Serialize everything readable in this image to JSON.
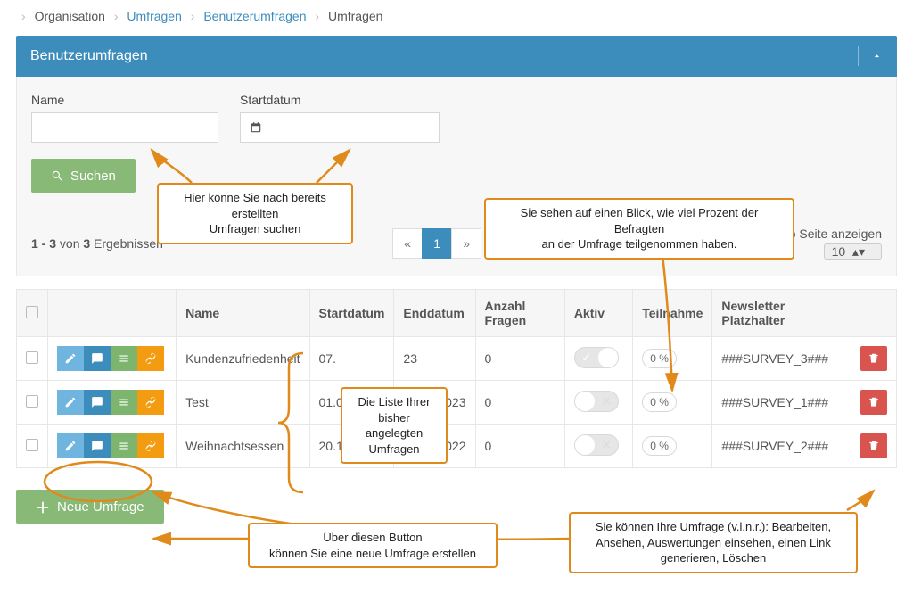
{
  "breadcrumb": {
    "root": "Organisation",
    "a": "Umfragen",
    "b": "Benutzerumfragen",
    "c": "Umfragen"
  },
  "panel": {
    "title": "Benutzerumfragen",
    "name_label": "Name",
    "date_label": "Startdatum",
    "search_btn": "Suchen",
    "results_text_prefix": "1 - 3",
    "results_text_mid": " von ",
    "results_text_count": "3",
    "results_text_suffix": " Ergebnissen",
    "per_page_label": "Ergebnisse pro Seite anzeigen",
    "per_page_value": "10",
    "page": "1",
    "prev": "«",
    "next": "»"
  },
  "columns": {
    "name": "Name",
    "start": "Startdatum",
    "end": "Enddatum",
    "questions": "Anzahl Fragen",
    "active": "Aktiv",
    "participation": "Teilnahme",
    "placeholder": "Newsletter Platzhalter"
  },
  "rows": [
    {
      "name": "Kundenzufriedenheit",
      "start": "07.",
      "end": "23",
      "q": "0",
      "active": true,
      "pct": "0 %",
      "ph": "###SURVEY_3###"
    },
    {
      "name": "Test",
      "start": "01.01.2023",
      "end": "09.01.2023",
      "q": "0",
      "active": false,
      "pct": "0 %",
      "ph": "###SURVEY_1###"
    },
    {
      "name": "Weihnachtsessen",
      "start": "20.12.2022",
      "end": "23.12.2022",
      "q": "0",
      "active": false,
      "pct": "0 %",
      "ph": "###SURVEY_2###"
    }
  ],
  "new_btn": "Neue Umfrage",
  "callouts": {
    "search": "Hier könne Sie nach bereits erstellten\nUmfragen suchen",
    "pct": "Sie sehen auf einen Blick, wie viel Prozent der Befragten\nan der Umfrage teilgenommen haben.",
    "list": "Die Liste Ihrer\nbisher angelegten\nUmfragen",
    "new": "Über diesen Button\nkönnen Sie eine neue Umfrage erstellen",
    "actions": "Sie können Ihre Umfrage (v.l.n.r.): Bearbeiten,\nAnsehen, Auswertungen einsehen, einen Link\ngenerieren, Löschen"
  }
}
